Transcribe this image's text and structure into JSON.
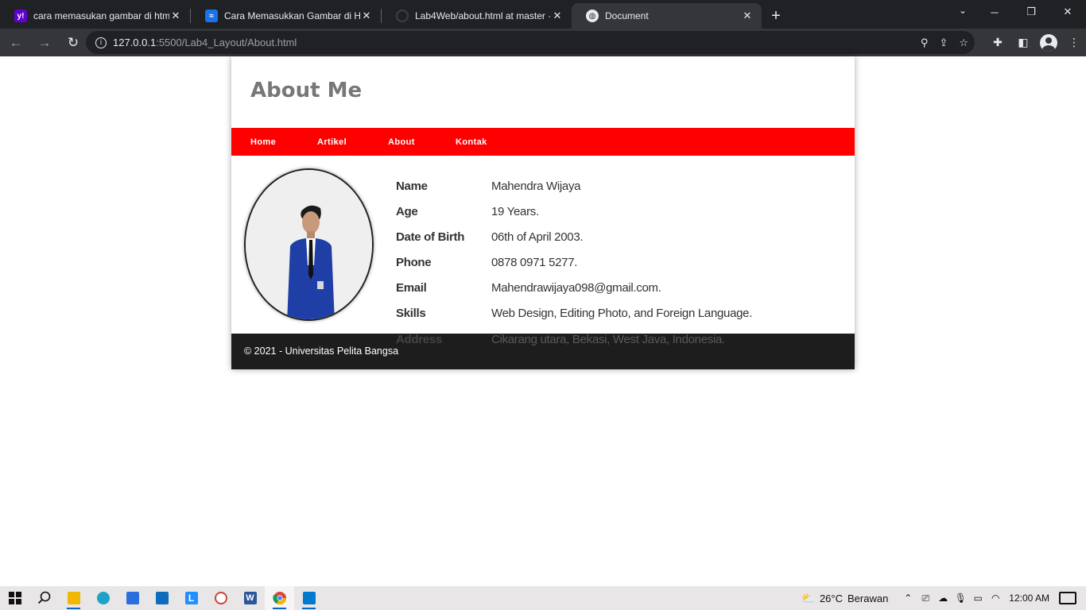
{
  "browser": {
    "tabs": [
      {
        "title": "cara memasukan gambar di html",
        "icon": "yahoo-icon",
        "color": "#6001d2",
        "glyph": "y!"
      },
      {
        "title": "Cara Memasukkan Gambar di HTML",
        "icon": "site-wave-icon",
        "color": "#1a73e8",
        "glyph": "≈"
      },
      {
        "title": "Lab4Web/about.html at master · ",
        "icon": "github-icon",
        "color": "#202124",
        "glyph": "◯"
      },
      {
        "title": "Document",
        "icon": "globe-icon",
        "color": "#35363a",
        "glyph": "◍"
      }
    ],
    "new_tab": "+",
    "url_host": "127.0.0.1",
    "url_path": ":5500/Lab4_Layout/About.html"
  },
  "page": {
    "title": "About Me",
    "nav": [
      "Home",
      "Artikel",
      "About",
      "Kontak"
    ],
    "profile_alt": "profile photo",
    "bio": [
      {
        "label": "Name",
        "value": "Mahendra Wijaya"
      },
      {
        "label": "Age",
        "value": "19 Years."
      },
      {
        "label": "Date of Birth",
        "value": "06th of April 2003."
      },
      {
        "label": "Phone",
        "value": "0878 0971 5277."
      },
      {
        "label": "Email",
        "value": "Mahendrawijaya098@gmail.com."
      },
      {
        "label": "Skills",
        "value": "Web Design, Editing Photo, and Foreign Language."
      },
      {
        "label": "Address",
        "value": "Cikarang utara, Bekasi, West Java, Indonesia."
      }
    ],
    "footer": "© 2021 - Universitas Pelita Bangsa",
    "colors": {
      "nav": "#ff0000",
      "footer": "#1d1d1d",
      "title": "#777777"
    }
  },
  "taskbar": {
    "weather_temp": "26°C",
    "weather_text": "Berawan",
    "clock": "12:00 AM"
  }
}
